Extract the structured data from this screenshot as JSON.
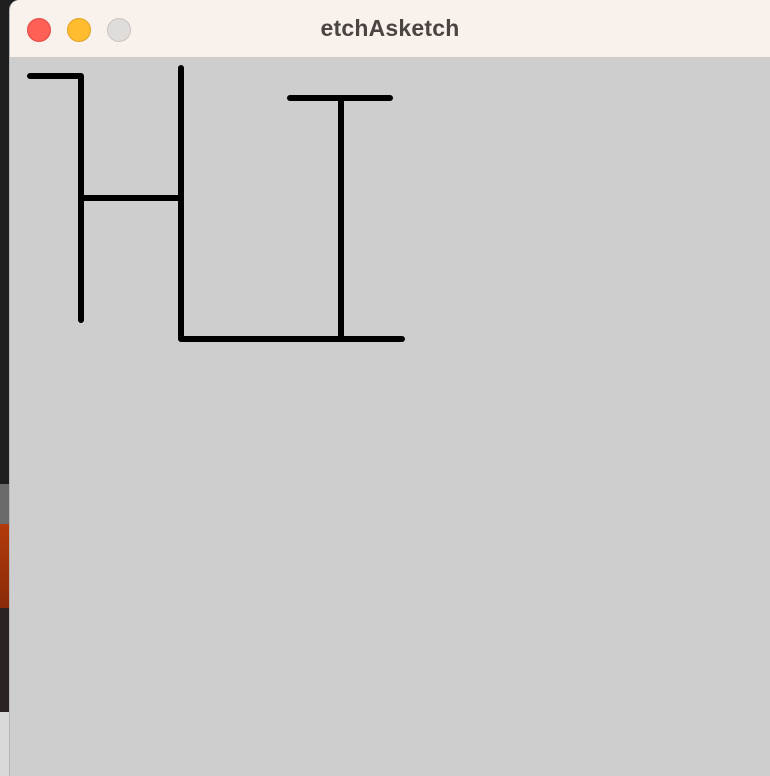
{
  "window": {
    "title": "etchAsketch"
  },
  "controls": {
    "close_icon": "close-icon",
    "minimize_icon": "minimize-icon",
    "zoom_icon": "zoom-icon"
  },
  "colors": {
    "titlebar": "#f9f1ec",
    "canvas_background": "#cecece",
    "stroke": "#000000",
    "close": "#fe5f57",
    "minimize": "#febc2e",
    "zoom_disabled": "#e0dcd9"
  }
}
